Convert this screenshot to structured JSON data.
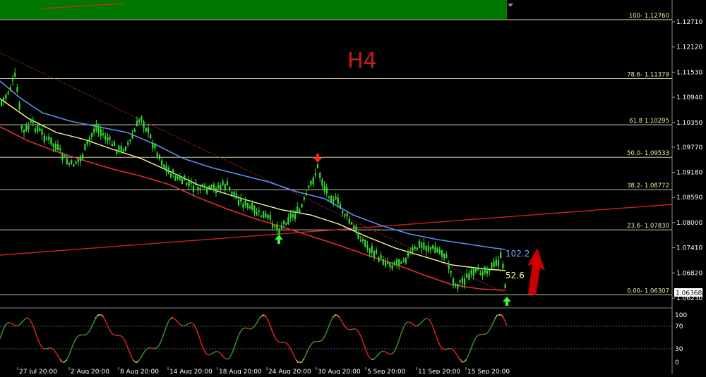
{
  "timeframe_label": "H4",
  "price_axis": {
    "ticks": [
      "1.12710",
      "1.12120",
      "1.11530",
      "1.10940",
      "1.10350",
      "1.09770",
      "1.09180",
      "1.08590",
      "1.08000",
      "1.07410",
      "1.06820",
      "1.06230"
    ],
    "current_price": "1.06368"
  },
  "fibonacci_levels": [
    {
      "label": "100- 1.12760",
      "price": 1.1276
    },
    {
      "label": "78.6- 1.11379",
      "price": 1.11379
    },
    {
      "label": "61.8 1.10295",
      "price": 1.10295
    },
    {
      "label": "50.0- 1.09533",
      "price": 1.09533
    },
    {
      "label": "38.2- 1.08772",
      "price": 1.08772
    },
    {
      "label": "23.6- 1.07830",
      "price": 1.0783
    },
    {
      "label": "0.00- 1.06307",
      "price": 1.06307
    }
  ],
  "ma_labels": {
    "blue": "102.2",
    "yellow": "52.6"
  },
  "oscillator_axis": {
    "ticks": [
      "100",
      "70",
      "30",
      "0"
    ]
  },
  "time_axis": [
    "27 Jul 20:00",
    "2 Aug 20:00",
    "8 Aug 20:00",
    "14 Aug 20:00",
    "18 Aug 20:00",
    "24 Aug 20:00",
    "30 Aug 20:00",
    "5 Sep 20:00",
    "11 Sep 20:00",
    "15 Sep 20:00"
  ],
  "colors": {
    "background": "#000000",
    "candles": "#33dd33",
    "ma_blue": "#5b8ff0",
    "ma_yellow": "#ffff99",
    "ma_red": "#e03030",
    "fib_line": "#e8e8c0",
    "banner": "#007800",
    "arrow_up_green": "#33ff33",
    "arrow_down_red": "#ff2020",
    "big_arrow": "#cc0000",
    "title": "#c81e1e"
  },
  "icons": [
    "arrow-up-icon",
    "arrow-down-icon",
    "big-up-arrow-icon"
  ]
}
